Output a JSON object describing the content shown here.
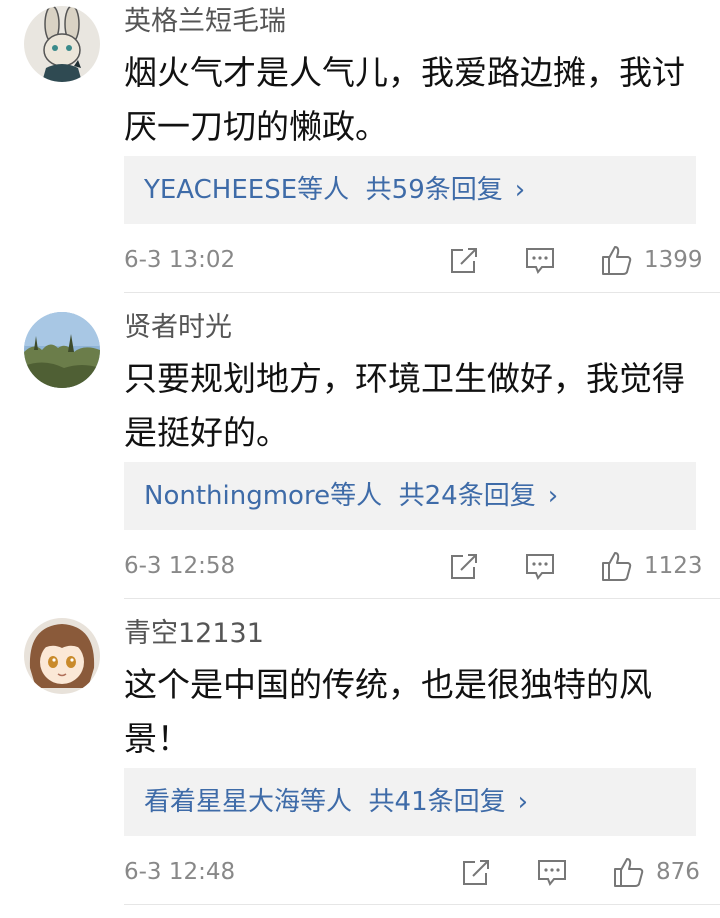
{
  "comments": [
    {
      "username": "英格兰短毛瑞",
      "text": "烟火气才是人气儿，我爱路边摊，我讨厌一刀切的懒政。",
      "reply_users": "YEACHEESE等人",
      "reply_count": "共59条回复",
      "reply_chevron": "›",
      "time": "6-3 13:02",
      "likes": "1399",
      "avatar_icon": "rabbit-avatar"
    },
    {
      "username": "贤者时光",
      "text": "只要规划地方，环境卫生做好，我觉得是挺好的。",
      "reply_users": "Nonthingmore等人",
      "reply_count": "共24条回复",
      "reply_chevron": "›",
      "time": "6-3 12:58",
      "likes": "1123",
      "avatar_icon": "landscape-avatar"
    },
    {
      "username": "青空12131",
      "text": "这个是中国的传统，也是很独特的风景！",
      "reply_users": "看着星星大海等人",
      "reply_count": "共41条回复",
      "reply_chevron": "›",
      "time": "6-3 12:48",
      "likes": "876",
      "avatar_icon": "anime-girl-avatar"
    }
  ],
  "colors": {
    "link": "#3e6ba8",
    "meta": "#888888",
    "reply_bg": "#f2f2f2"
  }
}
